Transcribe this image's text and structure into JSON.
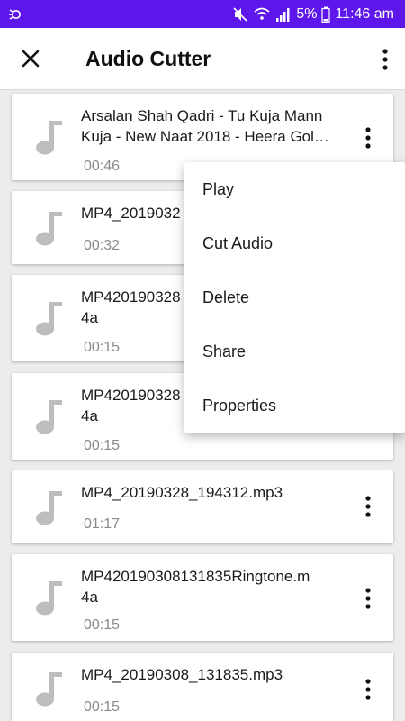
{
  "status_bar": {
    "battery": "5%",
    "time": "11:46 am"
  },
  "app_bar": {
    "title": "Audio Cutter",
    "close_icon": "close-icon",
    "more_icon": "more-vert-icon"
  },
  "files": [
    {
      "name": "Arsalan Shah Qadri - Tu Kuja Mann Kuja - New Naat 2018 - Heera Gol…",
      "duration": "00:46"
    },
    {
      "name": "MP4_2019032",
      "duration": "00:32"
    },
    {
      "name": "MP420190328\n4a",
      "duration": "00:15"
    },
    {
      "name": "MP420190328\n4a",
      "duration": "00:15"
    },
    {
      "name": "MP4_20190328_194312.mp3",
      "duration": "01:17"
    },
    {
      "name": "MP420190308131835Ringtone.m\n4a",
      "duration": "00:15"
    },
    {
      "name": "MP4_20190308_131835.mp3",
      "duration": "00:15"
    }
  ],
  "context_menu": {
    "items": [
      "Play",
      "Cut Audio",
      "Delete",
      "Share",
      "Properties"
    ]
  },
  "colors": {
    "status_bar": "#5e17eb",
    "icon_gray": "#bdbdbd"
  }
}
